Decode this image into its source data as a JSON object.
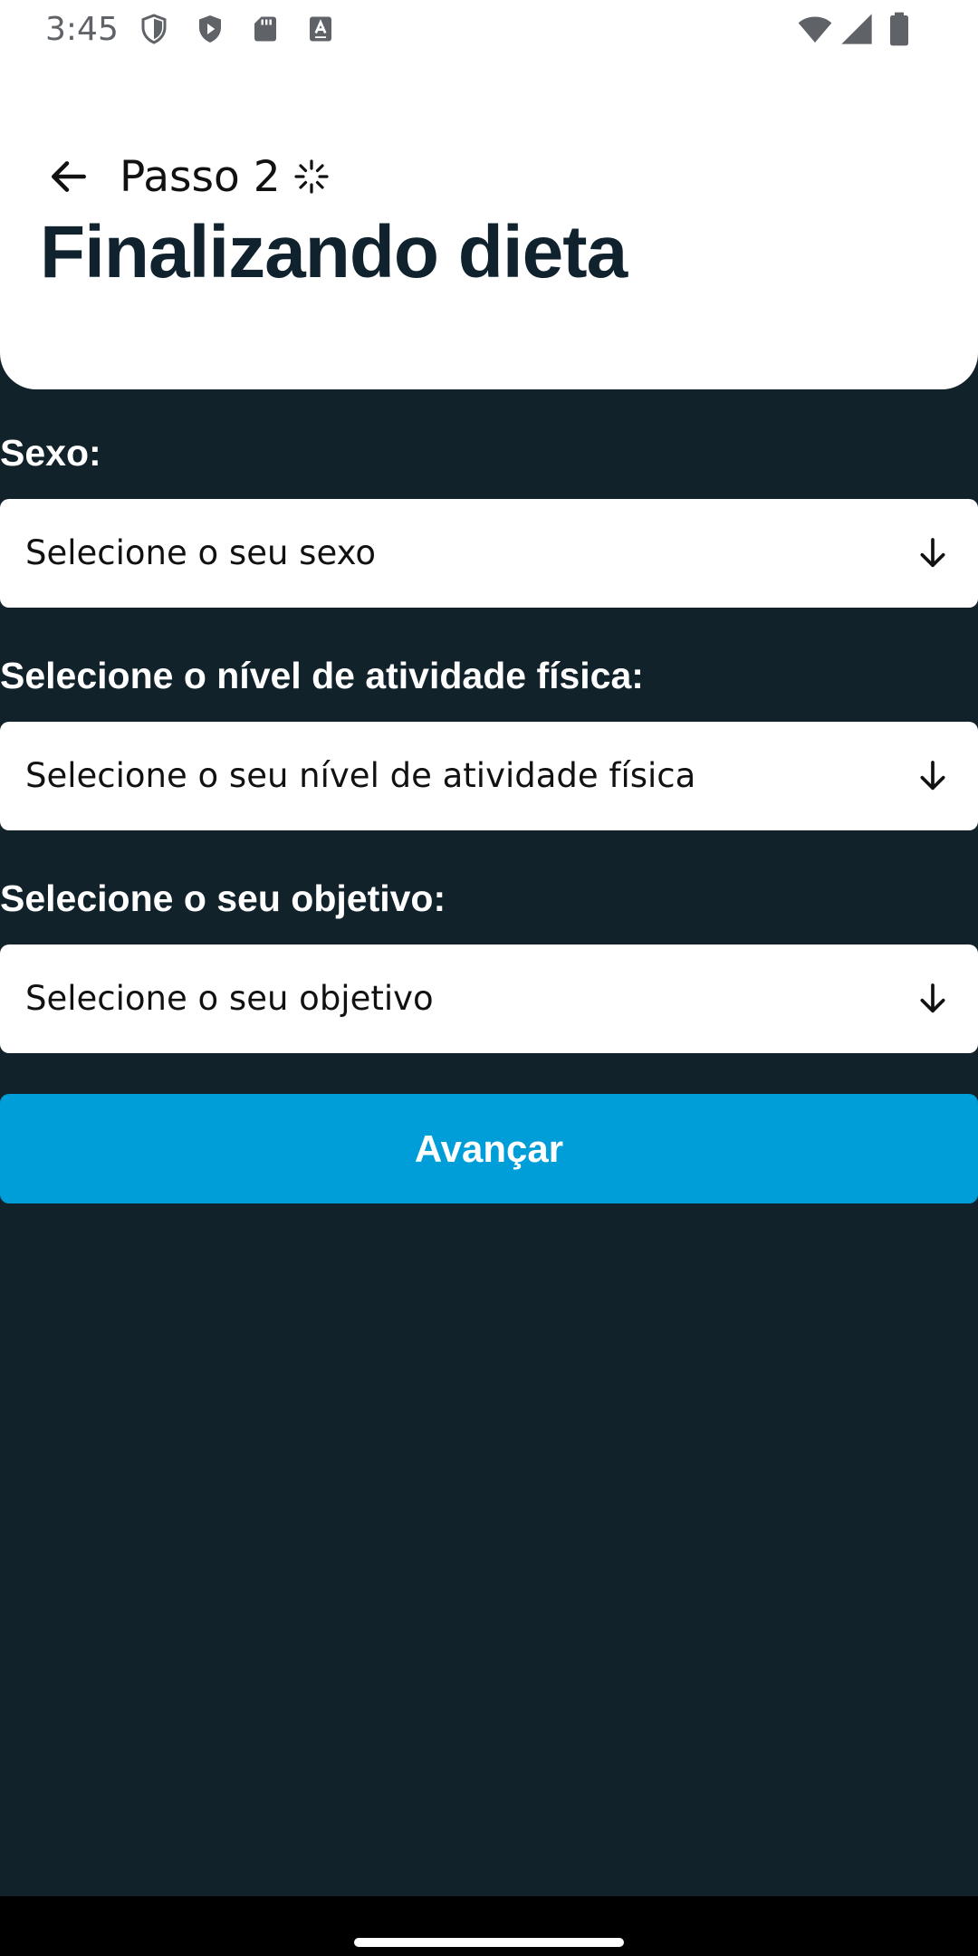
{
  "status_bar": {
    "time": "3:45",
    "left_icons": [
      "shield-outline-icon",
      "shield-play-icon",
      "sd-card-icon",
      "text-a-icon"
    ],
    "right_icons": [
      "wifi-icon",
      "signal-icon",
      "battery-icon"
    ]
  },
  "header": {
    "step_label": "Passo 2",
    "title": "Finalizando dieta",
    "background": "#ffffff"
  },
  "form": {
    "sex": {
      "label": "Sexo:",
      "placeholder": "Selecione o seu sexo"
    },
    "activity_level": {
      "label": "Selecione o nível de atividade física:",
      "placeholder": "Selecione o seu nível de atividade física"
    },
    "goal": {
      "label": "Selecione o seu objetivo:",
      "placeholder": "Selecione o seu objetivo"
    },
    "submit_label": "Avançar"
  },
  "colors": {
    "background": "#12222b",
    "accent": "#009ed8",
    "title": "#0f222d"
  }
}
